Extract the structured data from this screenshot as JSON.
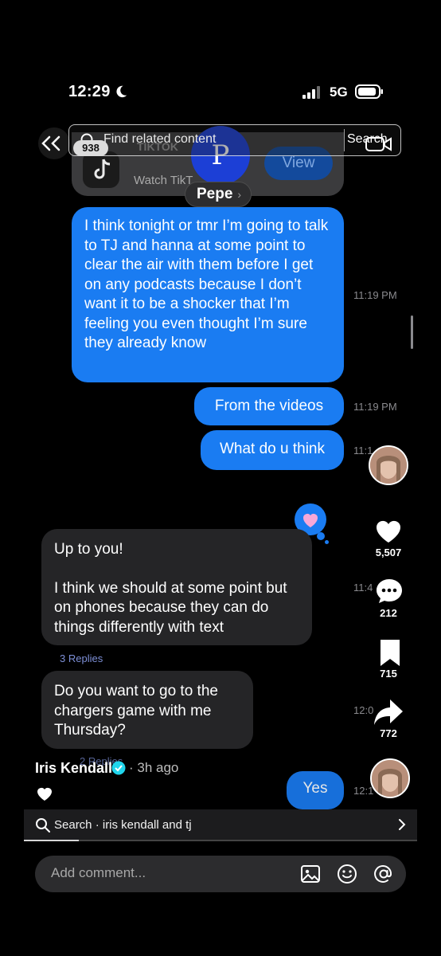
{
  "status_bar": {
    "time": "12:29",
    "network": "5G"
  },
  "search": {
    "placeholder": "Find related content",
    "button_label": "Search"
  },
  "preview": {
    "count_badge": "938",
    "title": "TIKTOK",
    "subtitle": "Watch TikT",
    "view_label": "View"
  },
  "contact": {
    "initial": "P",
    "name": "Pepe"
  },
  "messages": [
    {
      "text": "I think tonight or tmr I’m going to talk to TJ and hanna at some point to clear the air with them before I get on any podcasts because I don’t want it to be a shocker that I’m feeling you even thought I’m sure they already know",
      "time": "11:19 PM"
    },
    {
      "text": "From the videos",
      "time": "11:19 PM"
    },
    {
      "text": "What do u think",
      "time": "11:1"
    },
    {
      "line1": "Up to you!",
      "line2": "I think we should at some point but on phones because they can do things differently with text",
      "time": "11:4",
      "replies": "3 Replies"
    },
    {
      "text": "Do you want to go to the chargers game with me Thursday?",
      "time": "12:0",
      "replies": "2 Replies"
    },
    {
      "text": "Yes",
      "time": "12:1"
    }
  ],
  "actions": {
    "likes": "5,507",
    "comments": "212",
    "saves": "715",
    "shares": "772"
  },
  "author": {
    "name": "Iris Kendall",
    "posted": "· 3h ago"
  },
  "related_search": {
    "text": "Search · iris kendall and tj",
    "progress": 0.14
  },
  "comment_bar": {
    "placeholder": "Add comment..."
  },
  "colors": {
    "outgoing_bubble": "#1a7cf2",
    "incoming_bubble": "#252527",
    "background": "#000000"
  }
}
